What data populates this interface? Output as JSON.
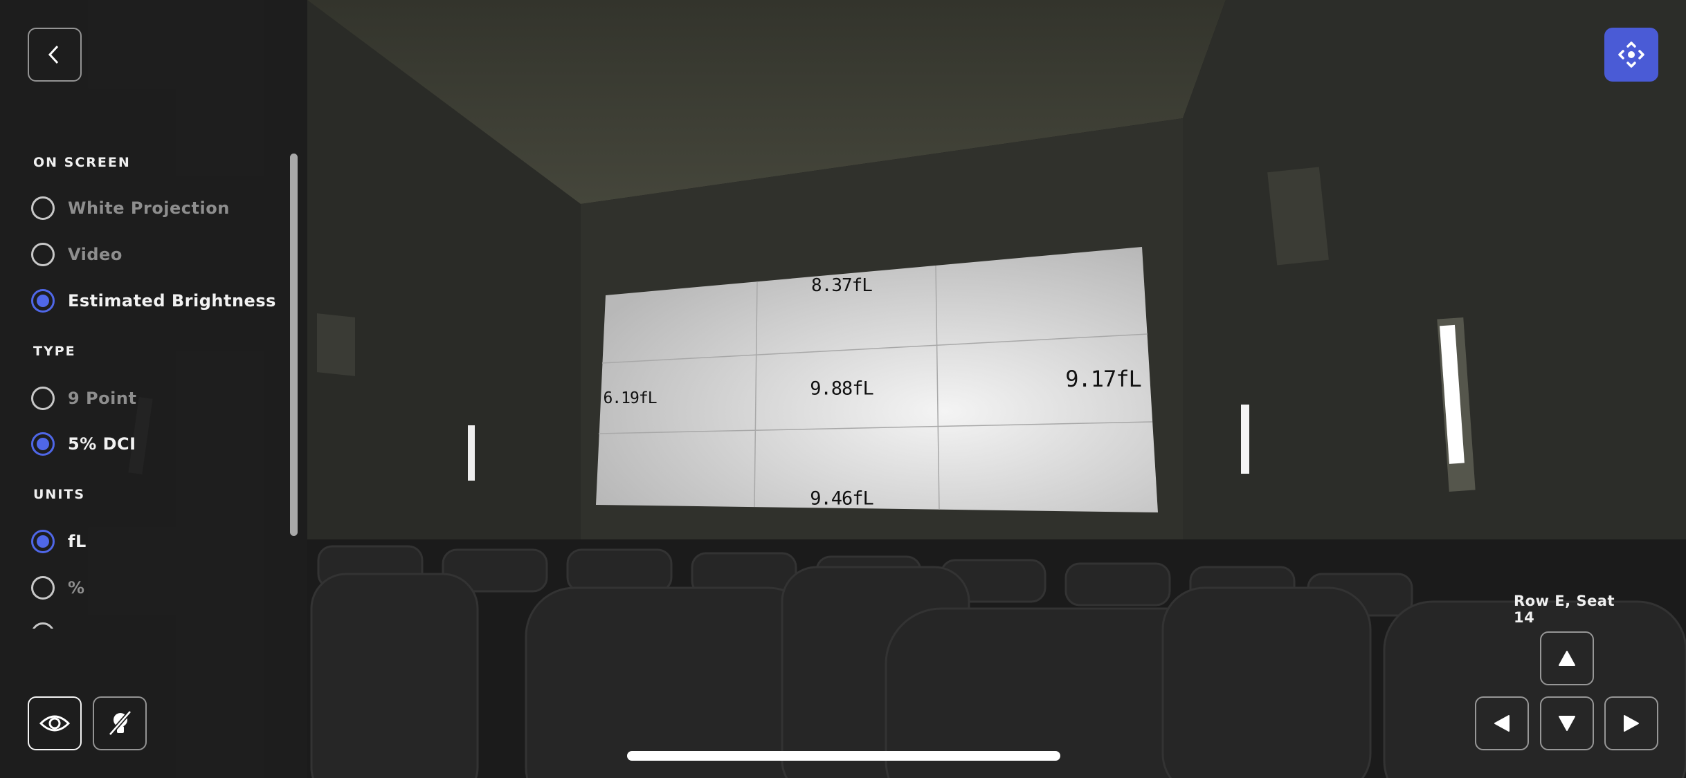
{
  "header": {
    "back_icon": "chevron-left-icon",
    "move_icon": "move-arrows-icon",
    "accent_color": "#4a5bd6"
  },
  "panel": {
    "sections": [
      {
        "title": "ON SCREEN",
        "options": [
          {
            "label": "White Projection",
            "selected": false
          },
          {
            "label": "Video",
            "selected": false
          },
          {
            "label": "Estimated Brightness",
            "selected": true
          }
        ]
      },
      {
        "title": "TYPE",
        "options": [
          {
            "label": "9 Point",
            "selected": false
          },
          {
            "label": "5% DCI",
            "selected": true
          }
        ]
      },
      {
        "title": "UNITS",
        "options": [
          {
            "label": "fL",
            "selected": true
          },
          {
            "label": "%",
            "selected": false
          }
        ]
      }
    ],
    "radio_color": "#4f67e8"
  },
  "bottom_tools": {
    "view_icon": "eye-icon",
    "lights_icon": "lightbulb-off-icon"
  },
  "screen_readings": {
    "top": "8.37fL",
    "left": "6.19fL",
    "center": "9.88fL",
    "right": "9.17fL",
    "bottom": "9.46fL"
  },
  "seat_nav": {
    "location": "Row E, Seat 14",
    "up_icon": "triangle-up-icon",
    "left_icon": "triangle-left-icon",
    "down_icon": "triangle-down-icon",
    "right_icon": "triangle-right-icon"
  }
}
